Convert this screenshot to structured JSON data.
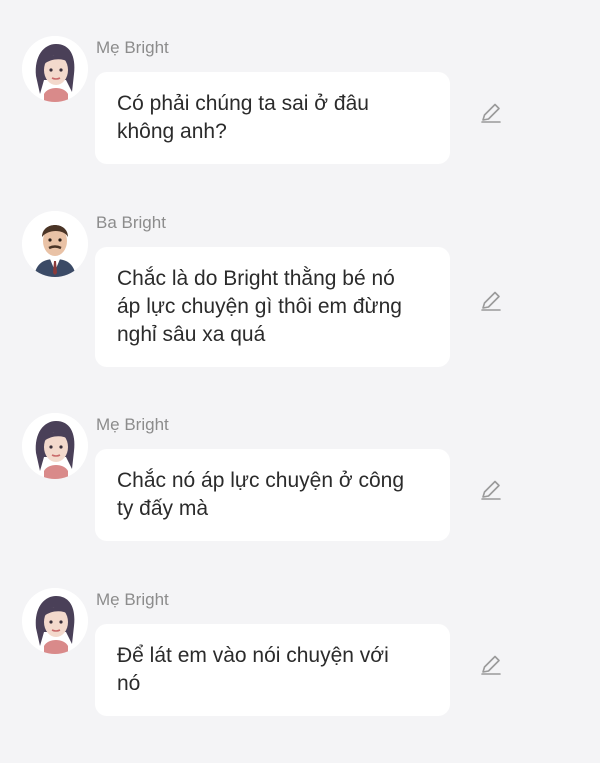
{
  "messages": [
    {
      "sender": "Mẹ Bright",
      "avatar": "mother-avatar",
      "text": "Có phải chúng ta sai ở đâu\nkhông anh?",
      "action_icon": "edit-pencil-icon"
    },
    {
      "sender": "Ba Bright",
      "avatar": "father-avatar",
      "text": "Chắc là do Bright thằng bé nó\náp lực chuyện gì thôi em đừng\nnghỉ sâu xa quá",
      "action_icon": "edit-pencil-icon"
    },
    {
      "sender": "Mẹ Bright",
      "avatar": "mother-avatar",
      "text": "Chắc nó áp lực chuyện ở công\nty đấy mà",
      "action_icon": "edit-pencil-icon"
    },
    {
      "sender": "Mẹ Bright",
      "avatar": "mother-avatar",
      "text": "Để lát em vào nói chuyện với\nnó",
      "action_icon": "edit-pencil-icon"
    }
  ],
  "colors": {
    "background": "#f4f4f6",
    "bubble": "#ffffff",
    "sender_name": "#8c8c8c",
    "message_text": "#2b2b2b",
    "icon": "#9a9a9a"
  }
}
